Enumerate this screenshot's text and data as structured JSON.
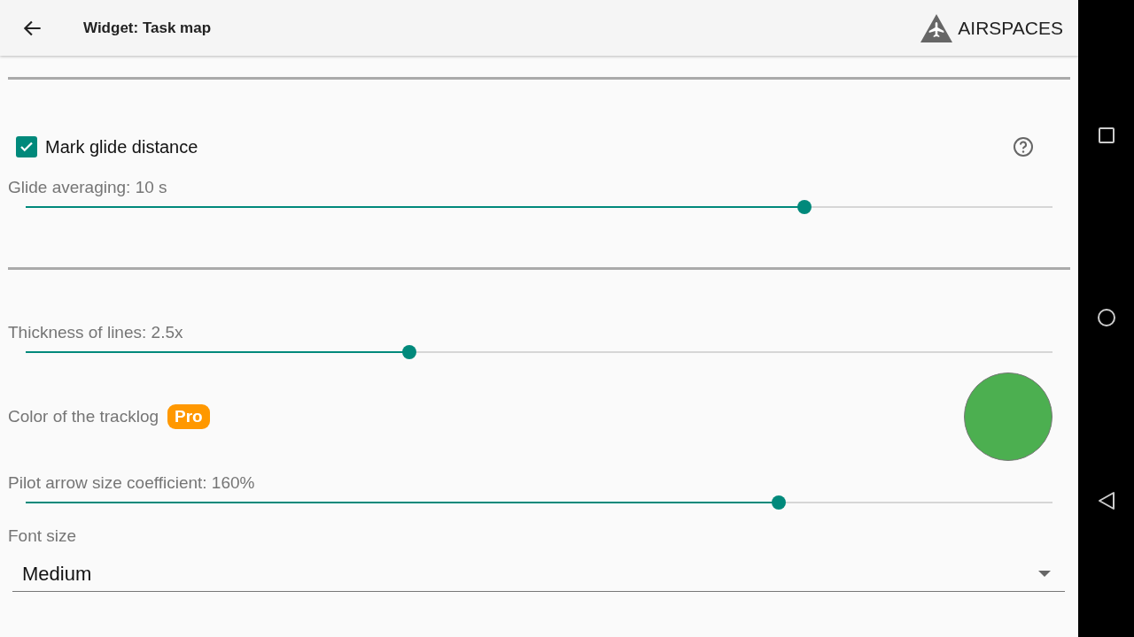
{
  "header": {
    "title": "Widget: Task map",
    "logo_text": "AIRSPACES"
  },
  "sections": [
    {
      "items": [
        {
          "kind": "checkbox",
          "label": "Mark glide distance",
          "checked": true
        },
        {
          "kind": "slider",
          "label": "Glide averaging: 10 s",
          "level": 0.758
        }
      ]
    },
    {
      "items": [
        {
          "kind": "slider",
          "label": "Thickness of lines: 2.5x",
          "level": 0.374
        },
        {
          "kind": "color",
          "label": "Color of the tracklog",
          "badge": "Pro",
          "color": "#4caf50"
        },
        {
          "kind": "slider",
          "label": "Pilot arrow size coefficient: 160%",
          "level": 0.733
        },
        {
          "kind": "dropdown",
          "label": "Font size",
          "value": "Medium"
        }
      ]
    }
  ]
}
